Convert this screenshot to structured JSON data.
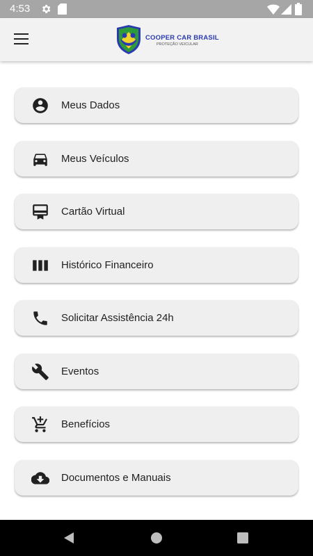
{
  "status_bar": {
    "time": "4:53"
  },
  "header": {
    "logo_title": "COOPER CAR BRASIL",
    "logo_subtitle": "PROTEÇÃO VEICULAR"
  },
  "menu": {
    "items": [
      {
        "label": "Meus Dados",
        "icon": "account-circle-icon"
      },
      {
        "label": "Meus Veículos",
        "icon": "car-icon"
      },
      {
        "label": "Cartão Virtual",
        "icon": "card-icon"
      },
      {
        "label": "Histórico Financeiro",
        "icon": "columns-icon"
      },
      {
        "label": "Solicitar Assistência 24h",
        "icon": "phone-icon"
      },
      {
        "label": "Eventos",
        "icon": "wrench-icon"
      },
      {
        "label": "Benefícios",
        "icon": "add-to-cart-icon"
      },
      {
        "label": "Documentos e Manuais",
        "icon": "cloud-download-icon"
      }
    ]
  },
  "colors": {
    "status_bar": "#a6a6a6",
    "app_bar": "#f2f2f2",
    "card": "#efefef",
    "logo_blue": "#2a3bb0",
    "logo_green": "#2e9b3a",
    "logo_yellow": "#f2d22e"
  }
}
